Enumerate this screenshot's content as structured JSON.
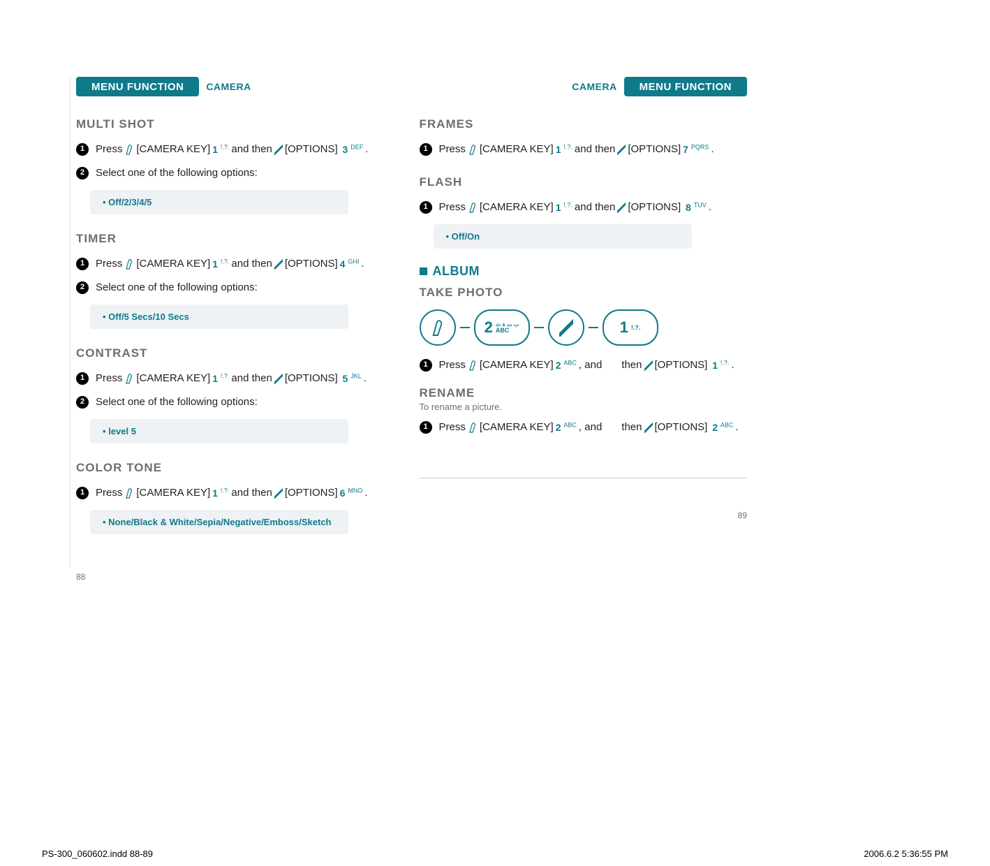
{
  "header": {
    "menu_function": "MENU FUNCTION",
    "camera": "CAMERA"
  },
  "left": {
    "multishot": {
      "title": "MULTI SHOT",
      "press": "Press",
      "camkey": "[CAMERA KEY]",
      "and_then": "and then",
      "options": "[OPTIONS]",
      "key1": "1",
      "key1sub": "!.?.",
      "key3": "3",
      "key3sub": "DEF",
      "select": "Select one of the following options:",
      "box": "Off/2/3/4/5"
    },
    "timer": {
      "title": "TIMER",
      "key4": "4",
      "key4sub": "GHI",
      "select": "Select one of the following options:",
      "box": "Off/5 Secs/10 Secs"
    },
    "contrast": {
      "title": "CONTRAST",
      "key5": "5",
      "key5sub": "JKL",
      "select": "Select one of the following options:",
      "box": "level 5"
    },
    "colortone": {
      "title": "COLOR TONE",
      "key6": "6",
      "key6sub": "MNO",
      "box": "None/Black & White/Sepia/Negative/Emboss/Sketch"
    },
    "page_num": "88"
  },
  "right": {
    "frames": {
      "title": "FRAMES",
      "key7": "7",
      "key7sub": "PQRS"
    },
    "flash": {
      "title": "FLASH",
      "key8": "8",
      "key8sub": "TUV",
      "box": "Off/On"
    },
    "album": {
      "heading": "ALBUM",
      "takephoto": "TAKE PHOTO",
      "seq_key2": "2",
      "seq_key2sub": "ABC",
      "seq_key1": "1",
      "seq_key1sub": "!.?.",
      "press": "Press",
      "camkey": "[CAMERA KEY]",
      "key2": "2",
      "key2sub": "ABC",
      "comma_and": ", and",
      "then": "then",
      "options": "[OPTIONS]",
      "key1": "1",
      "key1sub": "!.?."
    },
    "rename": {
      "title": "RENAME",
      "desc": "To rename a picture.",
      "key2b": "2",
      "key2bsub": "ABC"
    },
    "page_num": "89"
  },
  "footer": {
    "indd": "PS-300_060602.indd   88-89",
    "date": "2006.6.2   5:36:55 PM"
  }
}
